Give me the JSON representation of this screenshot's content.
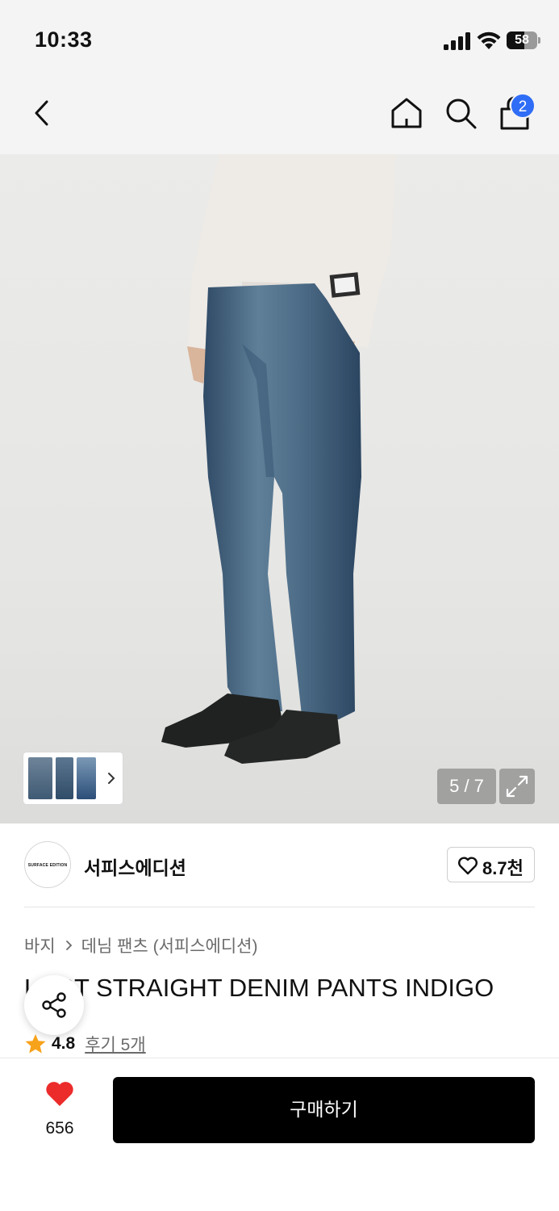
{
  "status_bar": {
    "time": "10:33",
    "battery": "58",
    "battery_level": 0.58
  },
  "nav": {
    "cart_count": "2",
    "badge_color": "#2f6df6"
  },
  "gallery": {
    "counter": "5 / 7",
    "current_index": 5,
    "total": 7
  },
  "brand": {
    "logo_text": "SURFACE EDITION",
    "name": "서피스에디션",
    "likes": "8.7천"
  },
  "breadcrumb": {
    "category": "바지",
    "subcategory": "데님 팬츠 (서피스에디션)"
  },
  "product": {
    "title": "LOST STRAIGHT DENIM PANTS INDIGO",
    "rating": "4.8",
    "reviews": "후기 5개"
  },
  "bottom_bar": {
    "like_count": "656",
    "buy_label": "구매하기",
    "heart_color": "#ec2b2b",
    "star_color": "#f7a21b"
  }
}
